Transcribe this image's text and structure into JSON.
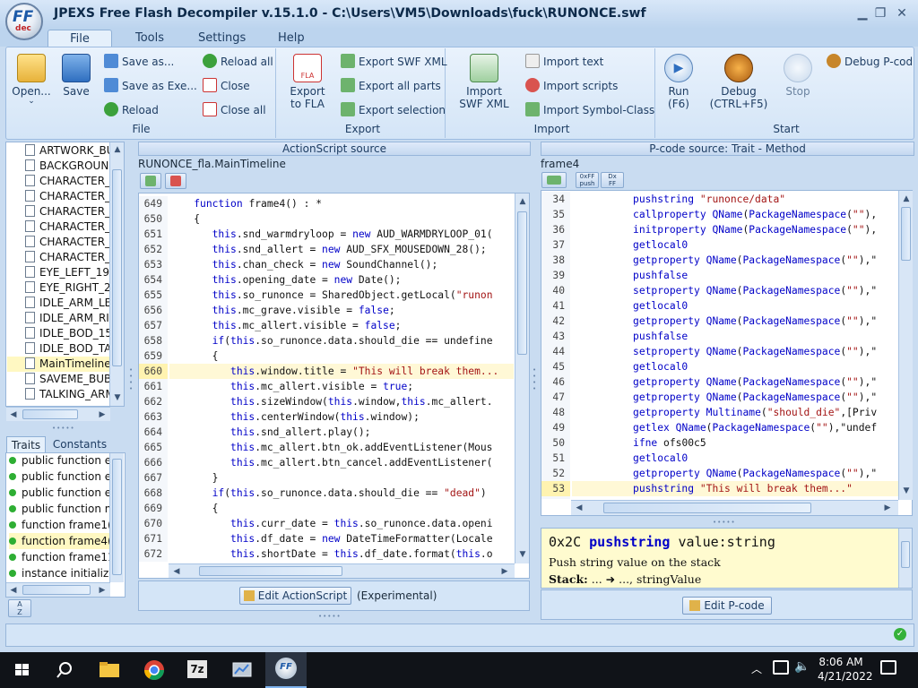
{
  "window": {
    "title": "JPEXS Free Flash Decompiler v.15.1.0 - C:\\Users\\VM5\\Downloads\\fuck\\RUNONCE.swf",
    "logo_text": "FF",
    "logo_sub": "dec"
  },
  "menu_tabs": [
    "File",
    "Tools",
    "Settings",
    "Help"
  ],
  "ribbon": {
    "file": {
      "label": "File",
      "open": "Open...",
      "save": "Save",
      "save_as": "Save as...",
      "save_as_exe": "Save as Exe...",
      "reload": "Reload",
      "reload_all": "Reload all",
      "close": "Close",
      "close_all": "Close all"
    },
    "export": {
      "label": "Export",
      "export_fla": "Export",
      "export_fla2": "to FLA",
      "fla_badge": "FLA",
      "export_swf_xml": "Export SWF XML",
      "export_all_parts": "Export all parts",
      "export_selection": "Export selection"
    },
    "import": {
      "label": "Import",
      "import_swf_xml": "Import",
      "import_swf_xml2": "SWF XML",
      "import_text": "Import text",
      "import_scripts": "Import scripts",
      "import_symbol_class": "Import Symbol-Class"
    },
    "start": {
      "label": "Start",
      "run": "Run",
      "run_key": "(F6)",
      "debug": "Debug",
      "debug_key": "(CTRL+F5)",
      "stop": "Stop",
      "debug_pcode": "Debug P-code"
    }
  },
  "tree_items": [
    "ARTWORK_BU",
    "BACKGROUNI",
    "CHARACTER_",
    "CHARACTER_",
    "CHARACTER_",
    "CHARACTER_",
    "CHARACTER_",
    "CHARACTER_",
    "EYE_LEFT_19",
    "EYE_RIGHT_2",
    "IDLE_ARM_LE",
    "IDLE_ARM_RI",
    "IDLE_BOD_15",
    "IDLE_BOD_TA",
    "MainTimeline",
    "SAVEME_BUB",
    "TALKING_ARM"
  ],
  "traits_tabs": [
    "Traits",
    "Constants"
  ],
  "traits": [
    "public function e",
    "public function e",
    "public function e",
    "public function m",
    "function frame1(",
    "function frame4(",
    "function frame11",
    "instance initialize"
  ],
  "actionscript": {
    "header": "ActionScript source",
    "class_name": "RUNONCE_fla.MainTimeline",
    "edit_button": "Edit ActionScript",
    "experimental": "(Experimental)",
    "lines": [
      {
        "n": "649",
        "t": "    function frame4() : *"
      },
      {
        "n": "650",
        "t": "    {"
      },
      {
        "n": "651",
        "t": "       this.snd_warmdryloop = new AUD_WARMDRYLOOP_01("
      },
      {
        "n": "652",
        "t": "       this.snd_allert = new AUD_SFX_MOUSEDOWN_28();"
      },
      {
        "n": "653",
        "t": "       this.chan_check = new SoundChannel();"
      },
      {
        "n": "654",
        "t": "       this.opening_date = new Date();"
      },
      {
        "n": "655",
        "t": "       this.so_runonce = SharedObject.getLocal(\"runon"
      },
      {
        "n": "656",
        "t": "       this.mc_grave.visible = false;"
      },
      {
        "n": "657",
        "t": "       this.mc_allert.visible = false;"
      },
      {
        "n": "658",
        "t": "       if(this.so_runonce.data.should_die == undefine"
      },
      {
        "n": "659",
        "t": "       {"
      },
      {
        "n": "660",
        "t": "          this.window.title = \"This will break them..."
      },
      {
        "n": "661",
        "t": "          this.mc_allert.visible = true;"
      },
      {
        "n": "662",
        "t": "          this.sizeWindow(this.window,this.mc_allert."
      },
      {
        "n": "663",
        "t": "          this.centerWindow(this.window);"
      },
      {
        "n": "664",
        "t": "          this.snd_allert.play();"
      },
      {
        "n": "665",
        "t": "          this.mc_allert.btn_ok.addEventListener(Mous"
      },
      {
        "n": "666",
        "t": "          this.mc_allert.btn_cancel.addEventListener("
      },
      {
        "n": "667",
        "t": "       }"
      },
      {
        "n": "668",
        "t": "       if(this.so_runonce.data.should_die == \"dead\")"
      },
      {
        "n": "669",
        "t": "       {"
      },
      {
        "n": "670",
        "t": "          this.curr_date = this.so_runonce.data.openi"
      },
      {
        "n": "671",
        "t": "          this.df_date = new DateTimeFormatter(Locale"
      },
      {
        "n": "672",
        "t": "          this.shortDate = this.df_date.format(this.o"
      }
    ]
  },
  "pcode": {
    "header": "P-code source: Trait - Method",
    "method_name": "frame4",
    "edit_button": "Edit P-code",
    "push_btn_top": "0xFF",
    "push_btn_bottom": "push",
    "ff_btn_top": "Dx",
    "ff_btn_bottom": "FF",
    "lines": [
      {
        "n": "34",
        "t": "          pushstring \"runonce/data\""
      },
      {
        "n": "35",
        "t": "          callproperty QName(PackageNamespace(\"\"),"
      },
      {
        "n": "36",
        "t": "          initproperty QName(PackageNamespace(\"\"),"
      },
      {
        "n": "37",
        "t": "          getlocal0"
      },
      {
        "n": "38",
        "t": "          getproperty QName(PackageNamespace(\"\"),\""
      },
      {
        "n": "39",
        "t": "          pushfalse"
      },
      {
        "n": "40",
        "t": "          setproperty QName(PackageNamespace(\"\"),\""
      },
      {
        "n": "41",
        "t": "          getlocal0"
      },
      {
        "n": "42",
        "t": "          getproperty QName(PackageNamespace(\"\"),\""
      },
      {
        "n": "43",
        "t": "          pushfalse"
      },
      {
        "n": "44",
        "t": "          setproperty QName(PackageNamespace(\"\"),\""
      },
      {
        "n": "45",
        "t": "          getlocal0"
      },
      {
        "n": "46",
        "t": "          getproperty QName(PackageNamespace(\"\"),\""
      },
      {
        "n": "47",
        "t": "          getproperty QName(PackageNamespace(\"\"),\""
      },
      {
        "n": "48",
        "t": "          getproperty Multiname(\"should_die\",[Priv"
      },
      {
        "n": "49",
        "t": "          getlex QName(PackageNamespace(\"\"),\"undef"
      },
      {
        "n": "50",
        "t": "          ifne ofs00c5"
      },
      {
        "n": "51",
        "t": "          getlocal0"
      },
      {
        "n": "52",
        "t": "          getproperty QName(PackageNamespace(\"\"),\""
      },
      {
        "n": "53",
        "t": "          pushstring \"This will break them...\""
      }
    ],
    "doc": {
      "opcode": "0x2C",
      "name": "pushstring",
      "arg": "value:string",
      "desc": "Push string value on the stack",
      "stack_label": "Stack:",
      "stack_value": "... ➜ ..., stringValue"
    }
  },
  "taskbar": {
    "time": "8:06 AM",
    "date": "4/21/2022",
    "app_7z": "7z"
  },
  "colors": {
    "accent": "#1d5aa8",
    "ribbon_bg": "#d4e5f7",
    "highlight": "#fff8c2"
  }
}
